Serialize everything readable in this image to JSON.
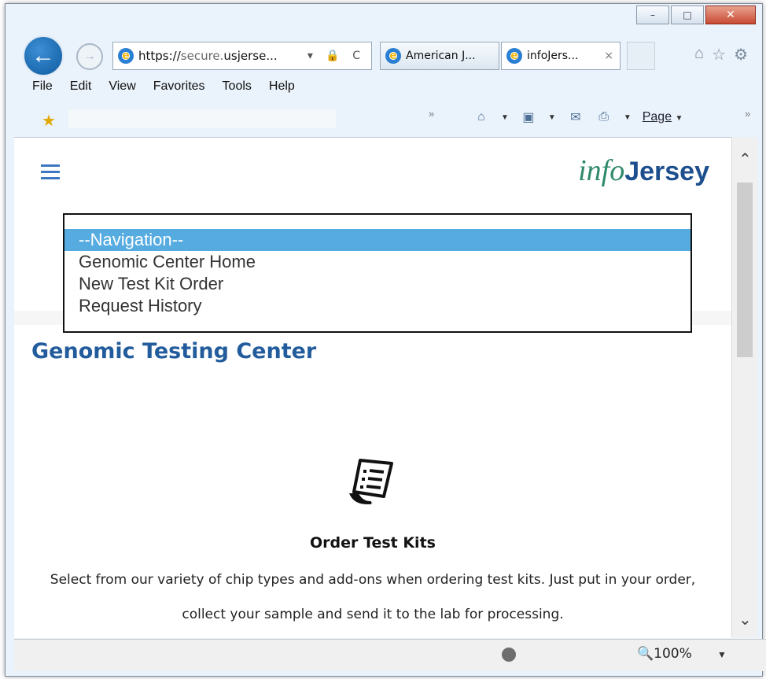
{
  "browser": {
    "address": {
      "url_scheme": "https://",
      "url_sub": "secure.",
      "url_host": "usjerse...",
      "controls": "▾ 🔒 C"
    },
    "tabs": [
      {
        "label": "American J..."
      },
      {
        "label": "infoJers...",
        "close": "×"
      }
    ],
    "menu": [
      "File",
      "Edit",
      "View",
      "Favorites",
      "Tools",
      "Help"
    ],
    "page_menu": "Page",
    "zoom": "100%"
  },
  "site": {
    "brand_info": "info",
    "brand_jersey": "Jersey",
    "nav_options": [
      {
        "label": "--Navigation--",
        "selected": true
      },
      {
        "label": "Genomic Center Home"
      },
      {
        "label": "New Test Kit Order"
      },
      {
        "label": "Request History"
      }
    ],
    "page_title": "Genomic Testing Center",
    "card": {
      "icon": "document-list-icon",
      "title": "Order Test Kits",
      "text": "Select from our variety of chip types and add-ons when ordering test kits. Just put in your order, collect your sample and send it to the lab for processing."
    }
  },
  "colors": {
    "accent": "#56ace0",
    "title": "#225c9c",
    "brand_info": "#2f8a6a",
    "brand_jersey": "#1d4f8e"
  }
}
